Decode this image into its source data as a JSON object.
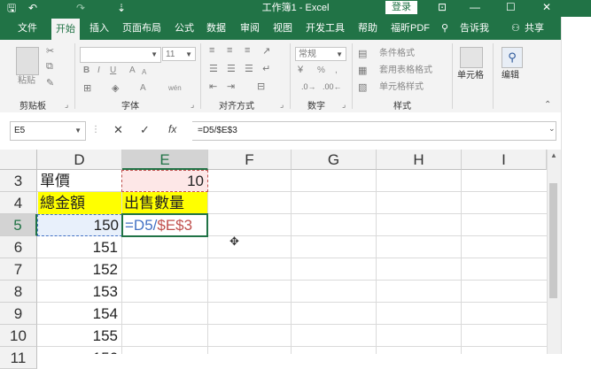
{
  "window": {
    "title": "工作簿1 - Excel",
    "login_label": "登录",
    "quick_access": {
      "save": "🖫",
      "undo": "↶",
      "redo": "↷",
      "more": "⇣"
    },
    "controls": {
      "ribbon_display": "⊡",
      "minimize": "—",
      "maximize": "☐",
      "close": "✕"
    }
  },
  "tabs": [
    {
      "label": "文件"
    },
    {
      "label": "开始"
    },
    {
      "label": "插入"
    },
    {
      "label": "页面布局"
    },
    {
      "label": "公式"
    },
    {
      "label": "数据"
    },
    {
      "label": "审阅"
    },
    {
      "label": "视图"
    },
    {
      "label": "开发工具"
    },
    {
      "label": "帮助"
    },
    {
      "label": "福昕PDF"
    },
    {
      "label": "告诉我"
    },
    {
      "label": "共享"
    }
  ],
  "ribbon": {
    "clipboard": {
      "label": "剪贴板",
      "paste": "粘贴"
    },
    "font": {
      "label": "字体",
      "font_size": "11",
      "bold": "B",
      "italic": "I",
      "underline": "U",
      "grow": "A",
      "shrink": "A",
      "color": "A",
      "wen": "wén"
    },
    "alignment": {
      "label": "对齐方式"
    },
    "number": {
      "label": "数字",
      "format": "常规",
      "percent": "%",
      "comma": ","
    },
    "styles": {
      "label": "样式",
      "conditional": "条件格式",
      "table": "套用表格格式",
      "cell": "单元格样式"
    },
    "cells": {
      "label": "单元格"
    },
    "editing": {
      "label": "编辑"
    }
  },
  "formula_bar": {
    "name_box": "E5",
    "cancel": "✕",
    "confirm": "✓",
    "fx": "fx",
    "formula": "=D5/$E$3"
  },
  "sheet": {
    "columns": [
      "D",
      "E",
      "F",
      "G",
      "H",
      "I"
    ],
    "rows": [
      "3",
      "4",
      "5",
      "6",
      "7",
      "8",
      "9",
      "10",
      "11"
    ],
    "cells": {
      "D3": "單價",
      "E3": "10",
      "D4": "總金額",
      "E4": "出售數量",
      "D5": "150",
      "E5_part1": "=D5/",
      "E5_part2": "$E$3",
      "D6": "151",
      "D7": "152",
      "D8": "153",
      "D9": "154",
      "D10": "155",
      "D11": "156"
    }
  },
  "colors": {
    "accent": "#217346",
    "highlight_yellow": "#ffff00",
    "ref_red_fill": "#fde7e7",
    "ref_blue_fill": "#e8f0fb",
    "ref_blue": "#4472c4",
    "ref_red": "#c0504d"
  }
}
